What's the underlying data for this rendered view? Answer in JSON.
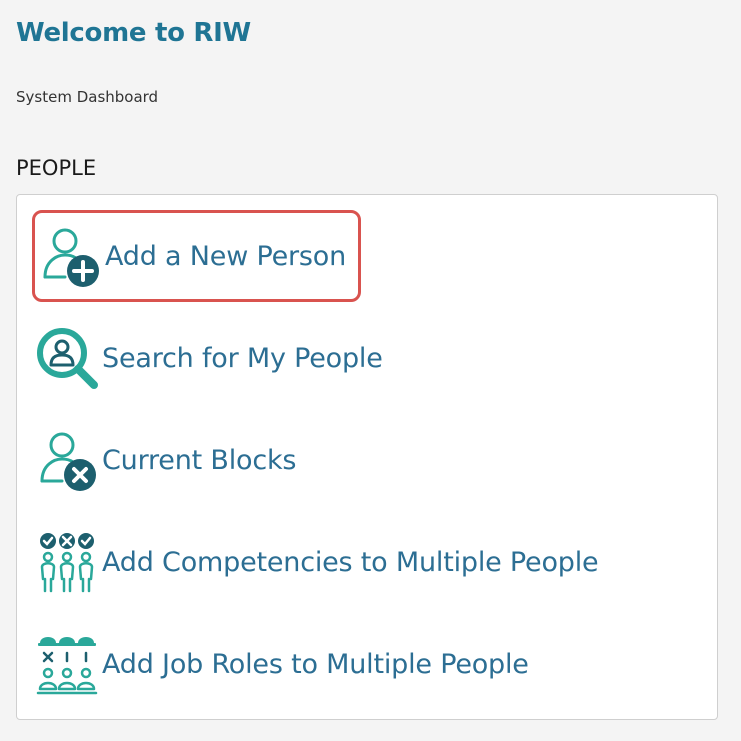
{
  "header": {
    "title": "Welcome to RIW",
    "subtitle": "System Dashboard"
  },
  "section": {
    "title": "PEOPLE"
  },
  "menu": {
    "items": [
      {
        "label": "Add a New Person",
        "icon": "add-person-icon",
        "highlighted": true
      },
      {
        "label": "Search for My People",
        "icon": "search-people-icon",
        "highlighted": false
      },
      {
        "label": "Current Blocks",
        "icon": "blocked-person-icon",
        "highlighted": false
      },
      {
        "label": "Add Competencies to Multiple People",
        "icon": "multi-competency-icon",
        "highlighted": false
      },
      {
        "label": "Add Job Roles to Multiple People",
        "icon": "multi-job-role-icon",
        "highlighted": false
      }
    ]
  },
  "colors": {
    "accent_teal": "#2aa89a",
    "dark_teal": "#1d5f6e",
    "label_blue": "#2c6e93",
    "title_blue": "#1f7594",
    "highlight_red": "#d9534f"
  }
}
